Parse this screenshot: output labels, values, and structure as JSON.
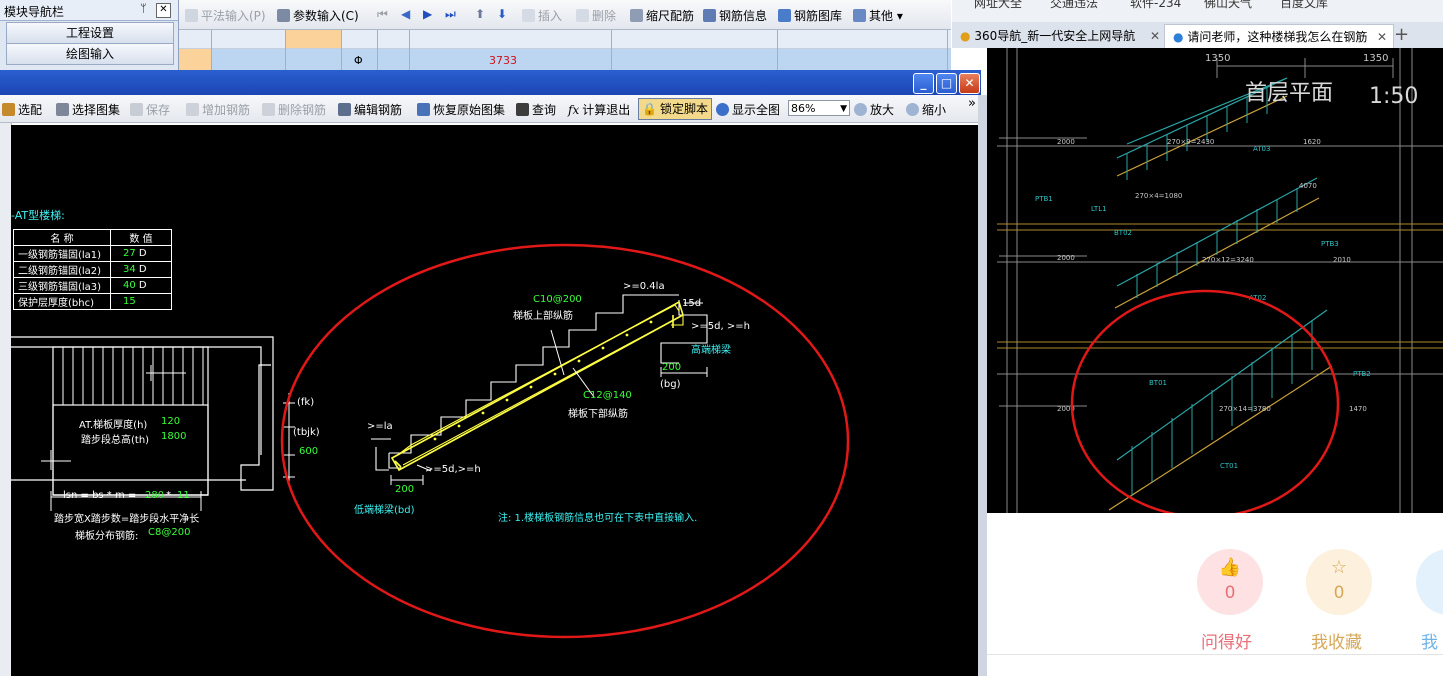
{
  "nav_panel": {
    "title": "模块导航栏",
    "pin": "ᛘ",
    "close": "✕",
    "buttons": [
      "工程设置",
      "绘图输入"
    ]
  },
  "bg_toolbar": {
    "items": [
      {
        "label": "平法输入(P)",
        "disabled": true
      },
      {
        "label": "参数输入(C)",
        "disabled": false
      },
      {
        "label": "插入",
        "disabled": true
      },
      {
        "label": "删除",
        "disabled": true
      },
      {
        "label": "缩尺配筋",
        "disabled": false
      },
      {
        "label": "钢筋信息",
        "disabled": false
      },
      {
        "label": "钢筋图库",
        "disabled": false
      },
      {
        "label": "其他",
        "disabled": false
      }
    ],
    "grid_value": "3733",
    "grid_symbol": "Φ"
  },
  "browser": {
    "bookmarks": [
      "网址大全",
      "交通违法",
      "软件-234",
      "佛山天气",
      "百度文库"
    ],
    "tabs": [
      {
        "label": "360导航_新一代安全上网导航",
        "active": false
      },
      {
        "label": "请问老师，这种楼梯我怎么在钢筋",
        "active": true
      }
    ],
    "new_tab": "+",
    "drawing": {
      "dim_top": [
        "1350",
        "1350"
      ],
      "title": "首层平面",
      "scale": "1:50",
      "dims_left": [
        "2000",
        "2000",
        "2000"
      ],
      "dims_mid": [
        "270×9=2430",
        "270×12=3240",
        "270×14=3780"
      ],
      "dims_right": [
        "1620",
        "2010",
        "1470"
      ],
      "labels": [
        "AT03",
        "AT02",
        "BT02",
        "BT01",
        "CT01",
        "PTB1",
        "PTB2",
        "PTB3",
        "LTL1",
        "4070",
        "270×4=1080"
      ]
    },
    "stats": [
      {
        "count": "0",
        "label": "问得好",
        "color": "#e8707a"
      },
      {
        "count": "0",
        "label": "我收藏",
        "color": "#d7a85a"
      },
      {
        "count": "",
        "label": "我",
        "color": "#6fb4e6"
      }
    ]
  },
  "dialog": {
    "toolbar": [
      {
        "label": "选配",
        "disabled": false
      },
      {
        "label": "选择图集",
        "disabled": false
      },
      {
        "label": "保存",
        "disabled": true
      },
      {
        "label": "增加钢筋",
        "disabled": true
      },
      {
        "label": "删除钢筋",
        "disabled": true
      },
      {
        "label": "编辑钢筋",
        "disabled": false
      },
      {
        "label": "恢复原始图集",
        "disabled": false
      },
      {
        "label": "查询",
        "disabled": false
      },
      {
        "label": "计算退出",
        "disabled": false
      },
      {
        "label": "锁定脚本",
        "disabled": false
      },
      {
        "label": "显示全图",
        "disabled": false
      },
      {
        "label": "放大",
        "disabled": false
      },
      {
        "label": "缩小",
        "disabled": false
      }
    ],
    "zoom": "86%",
    "more": "»"
  },
  "cad": {
    "heading": "-AT型楼梯:",
    "table_headers": [
      "名 称",
      "数 值"
    ],
    "table_rows": [
      {
        "name": "一级钢筋锚固(la1)",
        "value": "27",
        "unit": "D"
      },
      {
        "name": "二级钢筋锚固(la2)",
        "value": "34",
        "unit": "D"
      },
      {
        "name": "三级钢筋锚固(la3)",
        "value": "40",
        "unit": "D"
      },
      {
        "name": "保护层厚度(bhc)",
        "value": "15",
        "unit": ""
      }
    ],
    "slab_thickness_label": "AT.梯板厚度(h)",
    "slab_thickness": "120",
    "stair_height_label": "踏步段总高(th)",
    "stair_height": "1800",
    "val_600": "600",
    "fk": "(fk)",
    "tbjk": "(tbjk)",
    "lsn_formula": "lsn = bs * m =",
    "bs": "280",
    "m": "11",
    "lsn_desc": "踏步宽X踏步数=踏步段水平净长",
    "dist_label": "梯板分布钢筋:",
    "dist_value": "C8@200",
    "top_bar_value": "C10@200",
    "top_bar_label": "梯板上部纵筋",
    "bottom_bar_value": "C12@140",
    "bottom_bar_label": "梯板下部纵筋",
    "ge_04la": ">=0.4la",
    "d15": "15d",
    "ge_5d_h": ">=5d, >=h",
    "high_beam": "高端梯梁",
    "w200": "200",
    "bg": "(bg)",
    "ge_la": ">=la",
    "ge_5d_h2": ">=5d,>=h",
    "w200b": "200",
    "low_beam": "低端梯梁(bd)",
    "note": "注: 1.楼梯板钢筋信息也可在下表中直接输入."
  }
}
